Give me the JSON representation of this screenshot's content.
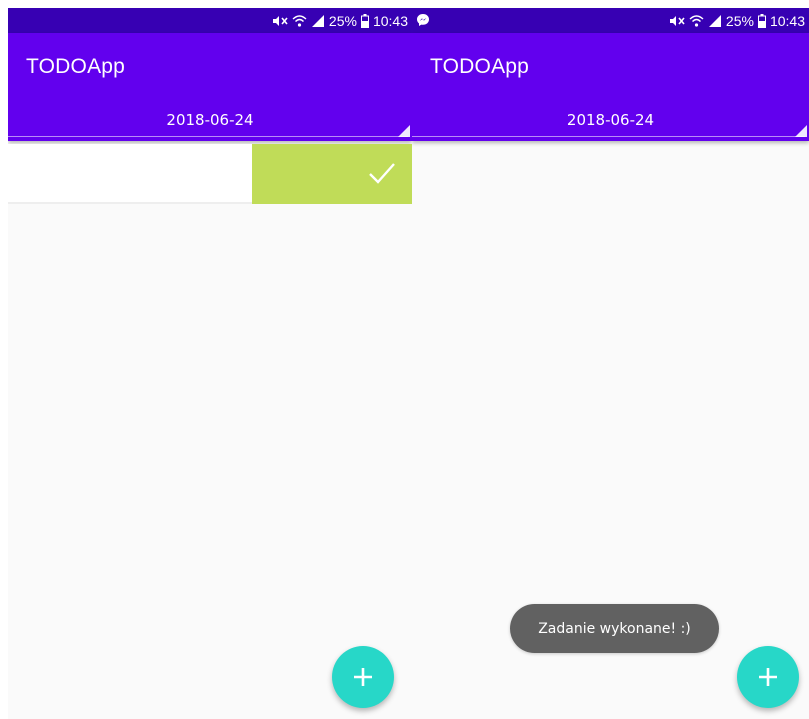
{
  "colors": {
    "status_bar": "#3700b3",
    "app_bar": "#6200ee",
    "swipe_done": "#c0dc58",
    "fab": "#27d7c8",
    "toast": "#616161",
    "background": "#fafafa"
  },
  "status_bar": {
    "battery_percent": "25%",
    "time": "10:43",
    "icons": [
      "mute-icon",
      "wifi-icon",
      "signal-icon",
      "battery-icon"
    ]
  },
  "screens": [
    {
      "app_title": "TODOApp",
      "date": "2018-06-24",
      "swipe_action_icon": "check-icon",
      "fab_icon": "plus-icon"
    },
    {
      "app_title": "TODOApp",
      "date": "2018-06-24",
      "notification_icon": "messenger-icon",
      "toast": "Zadanie wykonane! :)",
      "fab_icon": "plus-icon"
    }
  ]
}
